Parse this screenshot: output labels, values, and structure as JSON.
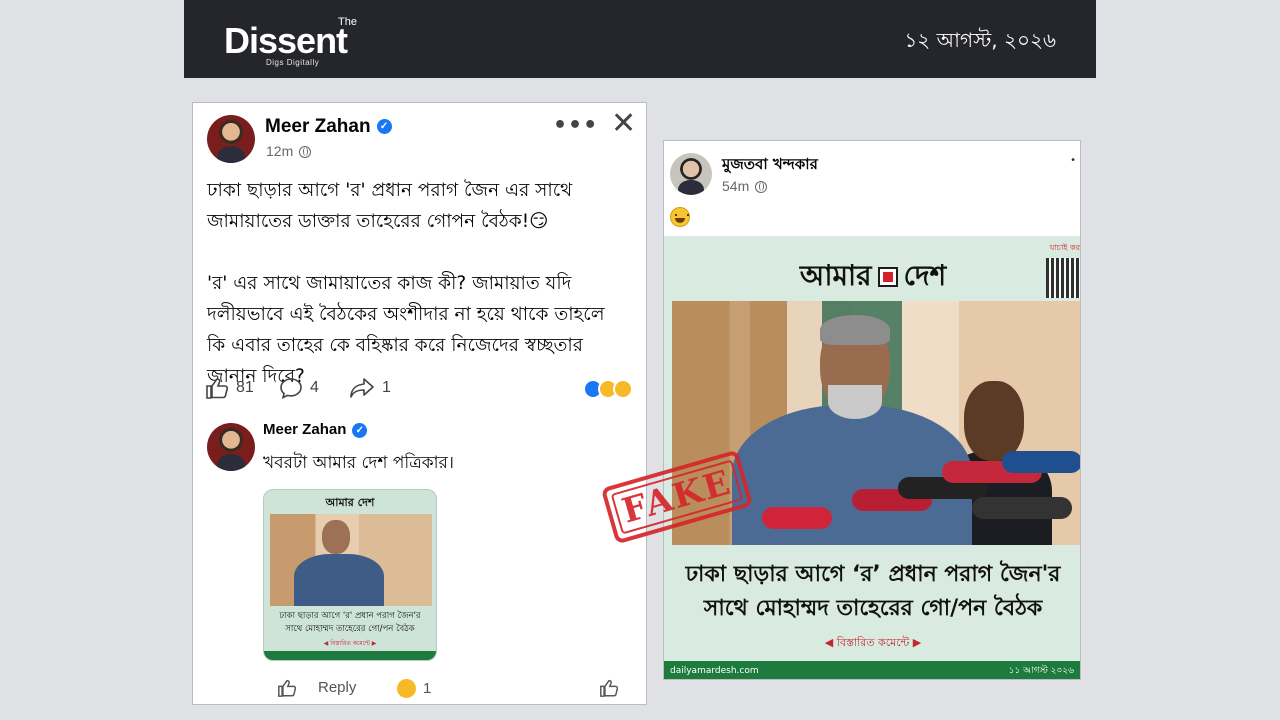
{
  "header": {
    "logo_main": "Dissent",
    "logo_the": "The",
    "logo_tagline": "Digs Digitally",
    "date": "১২ আগস্ট, ২০২৬"
  },
  "left_post": {
    "author": "Meer Zahan",
    "time": "12m",
    "text": "ঢাকা ছাড়ার আগে 'র' প্রধান পরাগ জৈন এর সাথে\nজামায়াতের ডাক্তার তাহেরের গোপন বৈঠক!😏\n\n'র' এর সাথে জামায়াতের কাজ কী? জামায়াত যদি\nদলীয়ভাবে এই বৈঠকের অংশীদার না হয়ে থাকে তাহলে\nকি এবার তাহের কে বহিষ্কার করে নিজেদের স্বচ্ছতার\nজানান দিবে?",
    "likes": "81",
    "comments": "4",
    "shares": "1",
    "reaction_colors": [
      "#1877f2",
      "#f7b928",
      "#f7b928"
    ],
    "comment": {
      "author": "Meer Zahan",
      "text": "খবরটা আমার দেশ পত্রিকার।",
      "mini_brand": "আমার  দেশ",
      "mini_caption": "ঢাকা ছাড়ার আগে 'র' প্রধান পরাগ জৈন'র\nসাথে মোহাম্মদ তাহেরের গো/পন বৈঠক",
      "mini_more": "◀ বিস্তারিত কমেন্টে ▶",
      "reply_label": "Reply",
      "reaction_count": "1"
    }
  },
  "right_post": {
    "author": "মুজতবা খন্দকার",
    "time": "54m",
    "news_brand_left": "আমার",
    "news_brand_right": "দেশ",
    "verify_label": "যাচাই কর",
    "caption": "ঢাকা ছাড়ার আগে ‘র’ প্রধান পরাগ জৈন'র\nসাথে মোহাম্মদ তাহেরের গো/পন বৈঠক",
    "more_label": "◀ বিস্তারিত কমেন্টে ▶",
    "site": "dailyamardesh.com",
    "footer_date": "১১ আগস্ট ২০২৬"
  },
  "stamp": {
    "label": "FAKE",
    "color": "#d6262b"
  },
  "colors": {
    "page_bg": "#dfe1e4",
    "header_bg": "#25262b",
    "verified_blue": "#1877f2",
    "news_green": "#1e7b3e"
  }
}
